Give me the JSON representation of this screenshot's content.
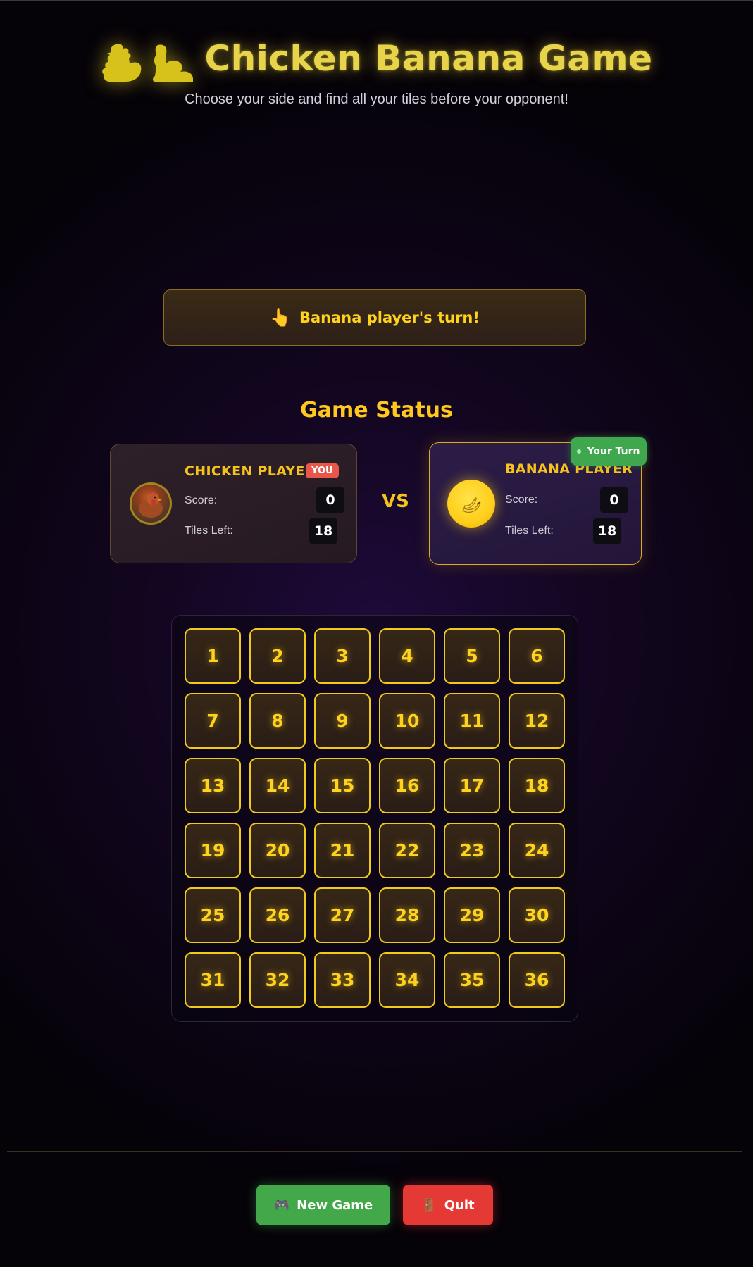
{
  "header": {
    "title": "Chicken Banana Game",
    "subtitle": "Choose your side and find all your tiles before your opponent!",
    "icons": [
      "chicken-silhouette-icon",
      "banana-silhouette-icon"
    ]
  },
  "turn_banner": {
    "icon": "pointing-hand-icon",
    "glyph": "👆",
    "text": "Banana player's turn!"
  },
  "status": {
    "title": "Game Status",
    "vs": "VS",
    "chicken": {
      "name": "CHICKEN PLAYER",
      "badge": "YOU",
      "score_label": "Score:",
      "score": "0",
      "tiles_label": "Tiles Left:",
      "tiles": "18"
    },
    "banana": {
      "name": "BANANA PLAYER",
      "turn_badge": "Your Turn",
      "score_label": "Score:",
      "score": "0",
      "tiles_label": "Tiles Left:",
      "tiles": "18"
    }
  },
  "board": {
    "tiles": [
      "1",
      "2",
      "3",
      "4",
      "5",
      "6",
      "7",
      "8",
      "9",
      "10",
      "11",
      "12",
      "13",
      "14",
      "15",
      "16",
      "17",
      "18",
      "19",
      "20",
      "21",
      "22",
      "23",
      "24",
      "25",
      "26",
      "27",
      "28",
      "29",
      "30",
      "31",
      "32",
      "33",
      "34",
      "35",
      "36"
    ]
  },
  "footer": {
    "new_game_icon": "🎮",
    "new_game_label": "New Game",
    "quit_icon": "🚪",
    "quit_label": "Quit"
  },
  "colors": {
    "accent_gold": "#ffd21e",
    "new_game_green": "#43a84a",
    "quit_red": "#e53935",
    "your_turn_green": "#3fa74e",
    "you_badge_red": "#e8574a"
  }
}
